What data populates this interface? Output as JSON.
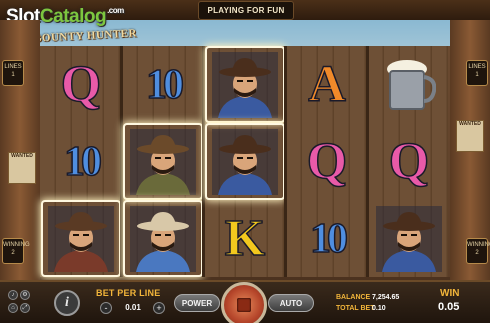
{
  "header": {
    "mode_label": "PLAYING FOR FUN",
    "watermark": {
      "part1": "Slot",
      "part2": "Catalog",
      "suffix": ".com"
    },
    "game_logo": "BOUNTY HUNTER"
  },
  "side_panels": {
    "left": {
      "lines_top_label": "LINES",
      "lines_top_value": "1",
      "winning_label": "WINNING",
      "winning_value": "2",
      "wanted_text": "WANTED"
    },
    "right": {
      "lines_top_label": "LINES",
      "lines_top_value": "1",
      "winning_label": "WINNING",
      "winning_value": "2",
      "wanted_text": "WANTED"
    }
  },
  "reels": [
    [
      {
        "symbol": "Q",
        "type": "letter",
        "color": "#e85aa8",
        "win": false
      },
      {
        "symbol": "10",
        "type": "letter",
        "color": "#4f8ee0",
        "win": false
      },
      {
        "symbol": "bandits",
        "type": "character",
        "win": true
      }
    ],
    [
      {
        "symbol": "10",
        "type": "letter",
        "color": "#4f8ee0",
        "win": false
      },
      {
        "symbol": "outlaw",
        "type": "character",
        "win": true
      },
      {
        "symbol": "sheriff-rider",
        "type": "character",
        "win": true
      }
    ],
    [
      {
        "symbol": "bounty-hunter",
        "type": "character",
        "win": true
      },
      {
        "symbol": "bounty-hunter",
        "type": "character",
        "win": true
      },
      {
        "symbol": "K",
        "type": "letter",
        "color": "#f2c81e",
        "win": false
      }
    ],
    [
      {
        "symbol": "A",
        "type": "letter",
        "color": "#f08a2a",
        "win": false
      },
      {
        "symbol": "Q",
        "type": "letter",
        "color": "#e85aa8",
        "win": false
      },
      {
        "symbol": "10",
        "type": "letter",
        "color": "#4f8ee0",
        "win": false
      }
    ],
    [
      {
        "symbol": "beer-mug",
        "type": "object",
        "win": false
      },
      {
        "symbol": "Q",
        "type": "letter",
        "color": "#e85aa8",
        "win": false
      },
      {
        "symbol": "bounty-hunter",
        "type": "character",
        "win": false
      }
    ]
  ],
  "controls": {
    "info_label": "i",
    "bet_per_line_label": "BET PER LINE",
    "bet_per_line_value": "0.01",
    "minus_label": "-",
    "plus_label": "+",
    "power_label": "POWER",
    "auto_label": "AUTO",
    "balance_label": "BALANCE",
    "balance_value": "7,254.65",
    "total_bet_label": "TOTAL BET",
    "total_bet_value": "0.10",
    "win_label": "WIN",
    "win_value": "0.05"
  },
  "colors": {
    "accent_gold": "#f2b53a",
    "frame_wood": "#6e5036",
    "win_glow": "#fff3c0"
  }
}
